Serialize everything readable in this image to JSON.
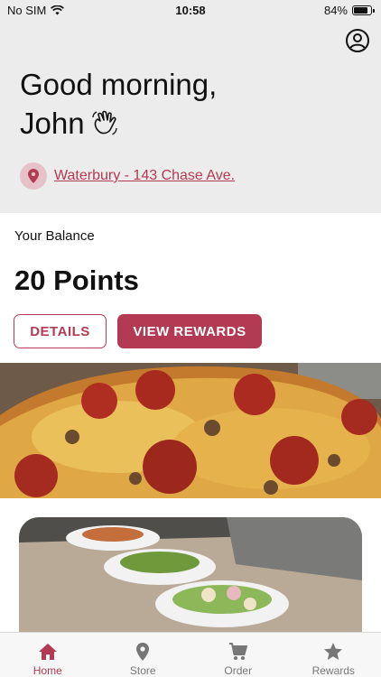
{
  "status_bar": {
    "carrier": "No SIM",
    "time": "10:58",
    "battery_percent": "84%",
    "battery_level": 0.84
  },
  "header": {
    "greeting_line1": "Good morning,",
    "greeting_line2": "John",
    "location": "Waterbury - 143 Chase Ave."
  },
  "balance": {
    "label": "Your Balance",
    "value": "20 Points"
  },
  "actions": {
    "details_label": "DETAILS",
    "view_rewards_label": "VIEW REWARDS"
  },
  "tabs": [
    {
      "label": "Home",
      "icon": "home-icon",
      "active": true
    },
    {
      "label": "Store",
      "icon": "location-pin-icon",
      "active": false
    },
    {
      "label": "Order",
      "icon": "cart-icon",
      "active": false
    },
    {
      "label": "Rewards",
      "icon": "star-icon",
      "active": false
    }
  ],
  "colors": {
    "accent": "#b23a52",
    "header_bg": "#ececec",
    "pin_bg": "#e6c2c8"
  }
}
